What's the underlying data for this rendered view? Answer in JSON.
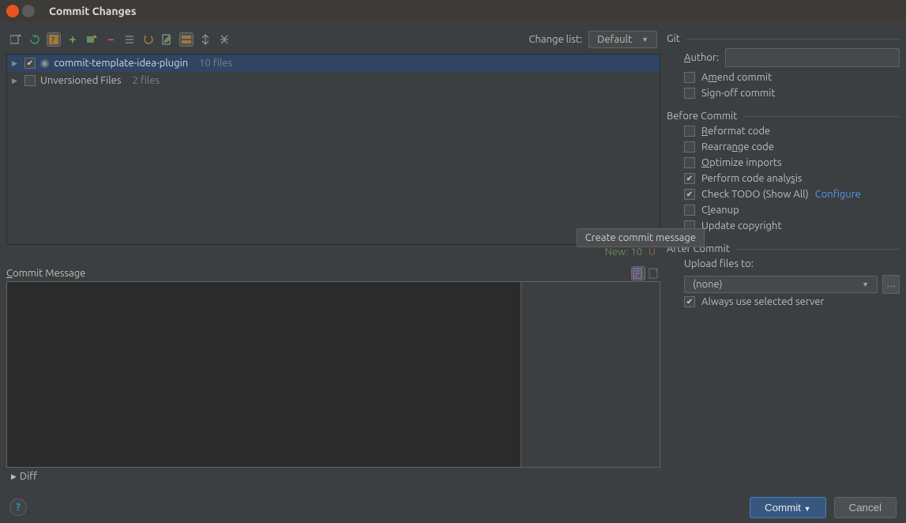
{
  "window": {
    "title": "Commit Changes"
  },
  "toolbar": {
    "change_list_label": "Change list:",
    "change_list_value": "Default"
  },
  "tree": {
    "items": [
      {
        "label": "commit-template-idea-plugin",
        "count": "10 files",
        "selected": true,
        "checked": true
      },
      {
        "label": "Unversioned Files",
        "count": "2 files",
        "selected": false,
        "checked": false
      }
    ]
  },
  "stats": {
    "new_label": "New:",
    "new_count": "10",
    "unversioned_label": "U"
  },
  "commit_message": {
    "label": "Commit Message",
    "value": ""
  },
  "tooltip": {
    "text": "Create commit message"
  },
  "diff": {
    "label": "Diff"
  },
  "git": {
    "title": "Git",
    "author_label": "Author:",
    "author_value": "",
    "amend": "Amend commit",
    "signoff": "Sign-off commit"
  },
  "before_commit": {
    "title": "Before Commit",
    "options": {
      "reformat": "Reformat code",
      "rearrange": "Rearrange code",
      "optimize": "Optimize imports",
      "analysis": "Perform code analysis",
      "todo": "Check TODO (Show All)",
      "configure": "Configure",
      "cleanup": "Cleanup",
      "copyright": "Update copyright"
    }
  },
  "after_commit": {
    "title": "After Commit",
    "upload_label": "Upload files to:",
    "upload_value": "(none)",
    "always": "Always use selected server"
  },
  "buttons": {
    "commit": "Commit",
    "cancel": "Cancel"
  }
}
